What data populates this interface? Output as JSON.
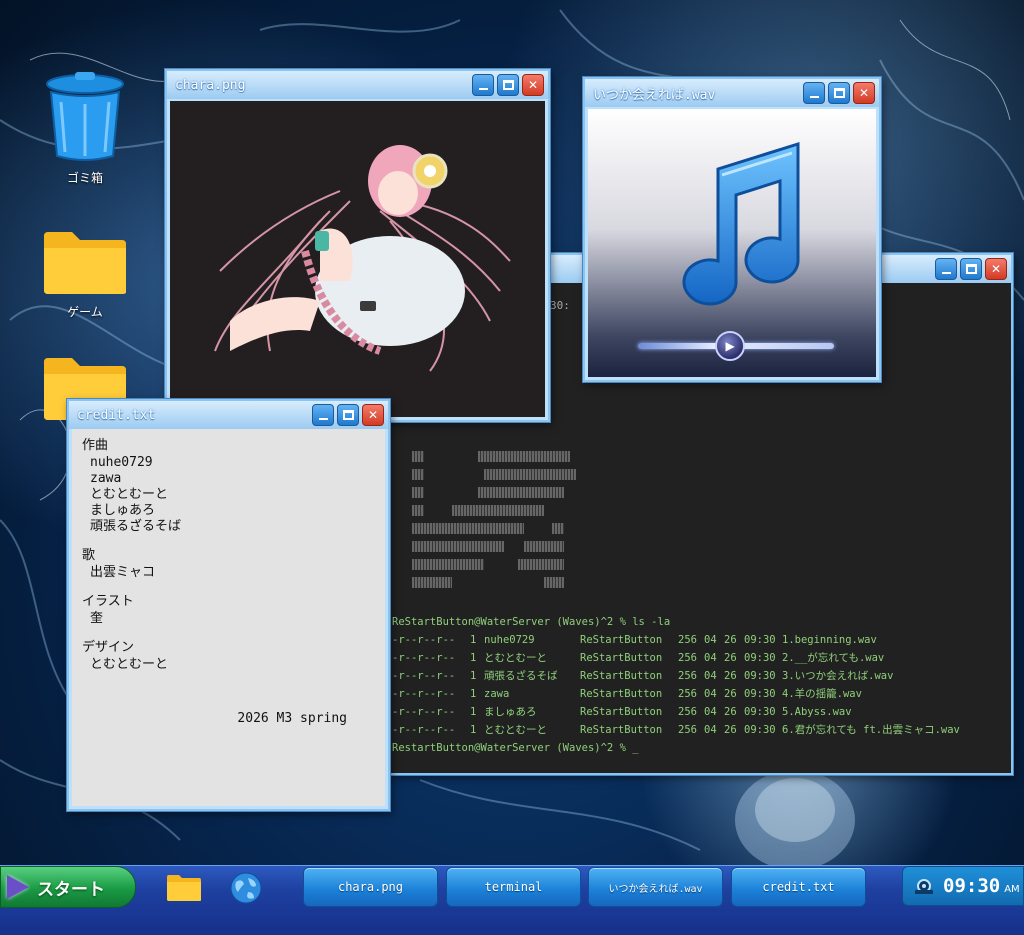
{
  "desktop": {
    "icons": [
      {
        "label": "ゴミ箱"
      },
      {
        "label": "ゲーム"
      },
      {
        "label": ""
      }
    ]
  },
  "windows": {
    "terminal": {
      "timestamp_fragment": "30:",
      "prompt1": "ReStartButton@WaterServer (Waves)^2 % ls -la",
      "files": [
        {
          "perm": "-r--r--r--",
          "links": "1",
          "owner": "nuhe0729",
          "group": "ReStartButton",
          "size": "256",
          "month": "04",
          "day": "26",
          "time": "09:30",
          "name": "1.beginning.wav"
        },
        {
          "perm": "-r--r--r--",
          "links": "1",
          "owner": "とむとむーと",
          "group": "ReStartButton",
          "size": "256",
          "month": "04",
          "day": "26",
          "time": "09:30",
          "name": "2.__が忘れても.wav"
        },
        {
          "perm": "-r--r--r--",
          "links": "1",
          "owner": "頑張るざるそば",
          "group": "ReStartButton",
          "size": "256",
          "month": "04",
          "day": "26",
          "time": "09:30",
          "name": "3.いつか会えれば.wav"
        },
        {
          "perm": "-r--r--r--",
          "links": "1",
          "owner": "zawa",
          "group": "ReStartButton",
          "size": "256",
          "month": "04",
          "day": "26",
          "time": "09:30",
          "name": "4.羊の揺籠.wav"
        },
        {
          "perm": "-r--r--r--",
          "links": "1",
          "owner": "ましゅあろ",
          "group": "ReStartButton",
          "size": "256",
          "month": "04",
          "day": "26",
          "time": "09:30",
          "name": "5.Abyss.wav"
        },
        {
          "perm": "-r--r--r--",
          "links": "1",
          "owner": "とむとむーと",
          "group": "ReStartButton",
          "size": "256",
          "month": "04",
          "day": "26",
          "time": "09:30",
          "name": "6.君が忘れても ft.出雲ミャコ.wav"
        }
      ],
      "prompt2": "RestartButton@WaterServer (Waves)^2 % _"
    },
    "chara": {
      "title": "chara.png"
    },
    "wav": {
      "title": "いつか会えれば.wav",
      "progress": 0.47
    },
    "credit": {
      "title": "credit.txt",
      "sections": [
        {
          "heading": "作曲",
          "names": [
            "nuhe0729",
            "zawa",
            "とむとむーと",
            "ましゅあろ",
            "頑張るざるそば"
          ]
        },
        {
          "heading": "歌",
          "names": [
            "出雲ミャコ"
          ]
        },
        {
          "heading": "イラスト",
          "names": [
            "奎"
          ]
        },
        {
          "heading": "デザイン",
          "names": [
            "とむとむーと"
          ]
        }
      ],
      "footer": "2026 M3 spring"
    }
  },
  "taskbar": {
    "start_label": "スタート",
    "tasks": [
      "chara.png",
      "terminal",
      "いつか会えれば.wav",
      "credit.txt"
    ],
    "clock": "09:30",
    "ampm": "AM"
  },
  "colors": {
    "terminal_text": "#8fd07a",
    "titlebar": "#9ccbf1",
    "taskbar": "#1e40a0",
    "start_button": "#1a9a44"
  }
}
